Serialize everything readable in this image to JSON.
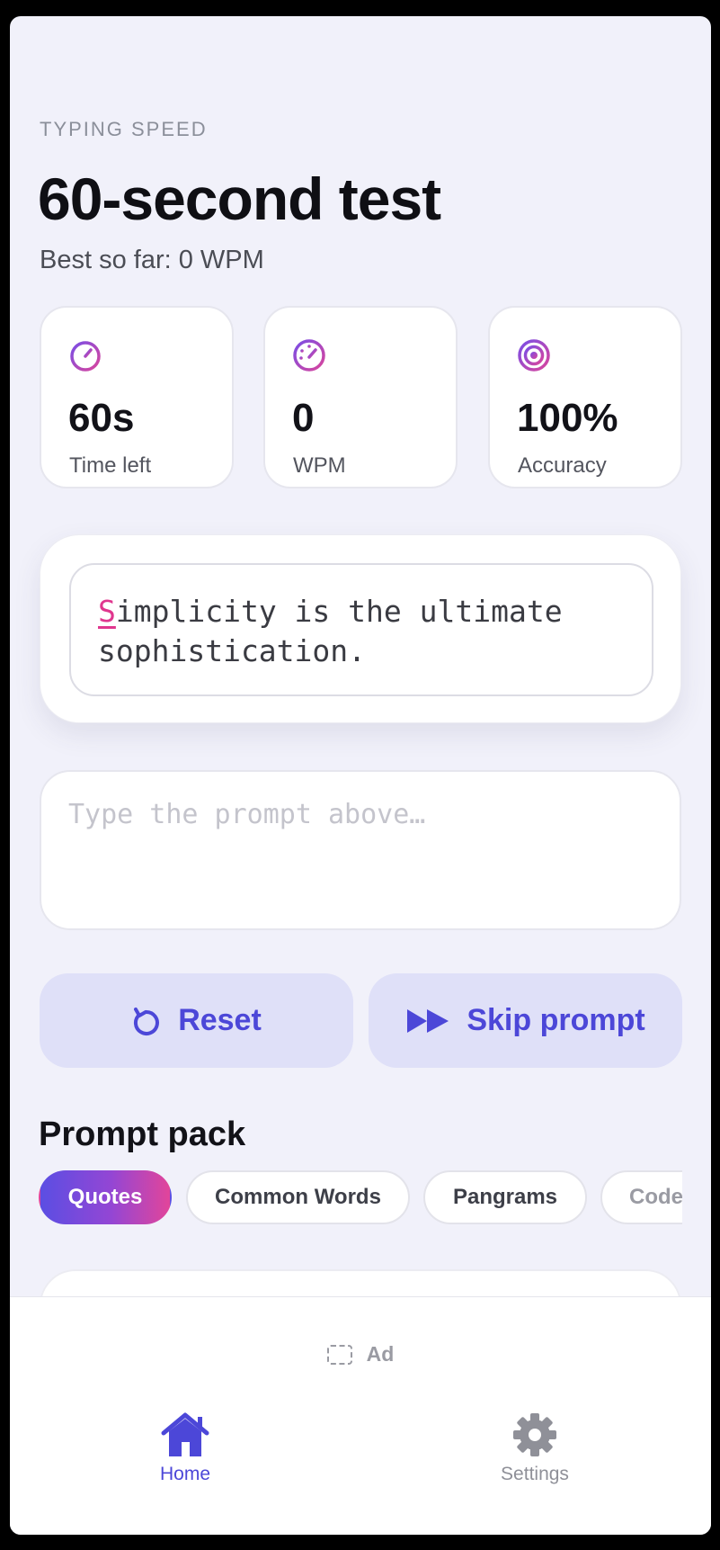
{
  "header": {
    "eyebrow": "TYPING SPEED",
    "title": "60-second test",
    "subtitle": "Best so far: 0 WPM"
  },
  "stats": [
    {
      "icon": "timer-icon",
      "value": "60s",
      "label": "Time left"
    },
    {
      "icon": "speedometer-icon",
      "value": "0",
      "label": "WPM"
    },
    {
      "icon": "target-icon",
      "value": "100%",
      "label": "Accuracy"
    }
  ],
  "prompt": {
    "current_char": "S",
    "remaining_line1": "implicity is the ultimate",
    "line2": "sophistication."
  },
  "input": {
    "placeholder": "Type the prompt above…",
    "value": ""
  },
  "actions": {
    "reset_label": "Reset",
    "skip_label": "Skip prompt"
  },
  "prompt_pack": {
    "heading": "Prompt pack",
    "chips": [
      {
        "label": "Quotes",
        "active": true
      },
      {
        "label": "Common Words",
        "active": false
      },
      {
        "label": "Pangrams",
        "active": false
      },
      {
        "label": "Code",
        "active": false
      }
    ]
  },
  "ad": {
    "label": "Ad"
  },
  "tabs": {
    "home_label": "Home",
    "settings_label": "Settings"
  },
  "colors": {
    "accent": "#4c47d8",
    "gradient_start": "#5b4ee3",
    "gradient_end": "#e2459a",
    "cursor_pink": "#e0368e"
  }
}
